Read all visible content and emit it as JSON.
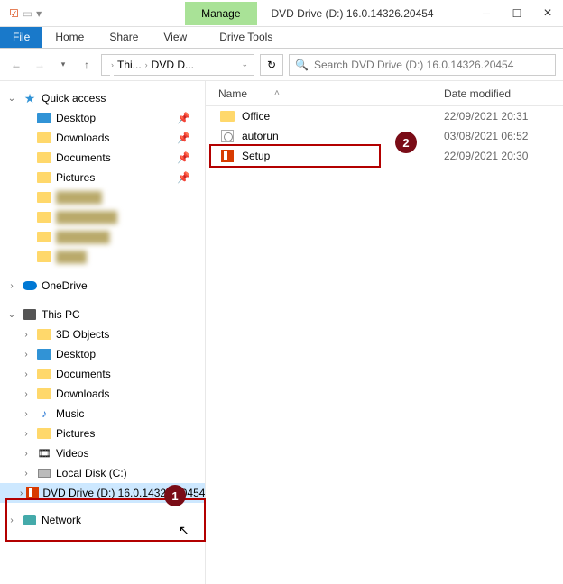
{
  "titlebar": {
    "manage": "Manage",
    "title": "DVD Drive (D:) 16.0.14326.20454"
  },
  "ribbon": {
    "file": "File",
    "home": "Home",
    "share": "Share",
    "view": "View",
    "drivetools": "Drive Tools"
  },
  "breadcrumb": {
    "item1": "Thi...",
    "item2": "DVD D..."
  },
  "search": {
    "placeholder": "Search DVD Drive (D:) 16.0.14326.20454"
  },
  "nav": {
    "quick_access": "Quick access",
    "desktop": "Desktop",
    "downloads": "Downloads",
    "documents": "Documents",
    "pictures": "Pictures",
    "onedrive": "OneDrive",
    "this_pc": "This PC",
    "objects3d": "3D Objects",
    "music": "Music",
    "videos": "Videos",
    "local_disk": "Local Disk (C:)",
    "dvd_drive": "DVD Drive (D:) 16.0.14326.20454",
    "network": "Network"
  },
  "columns": {
    "name": "Name",
    "date": "Date modified"
  },
  "files": {
    "office": {
      "name": "Office",
      "date": "22/09/2021 20:31"
    },
    "autorun": {
      "name": "autorun",
      "date": "03/08/2021 06:52"
    },
    "setup": {
      "name": "Setup",
      "date": "22/09/2021 20:30"
    }
  },
  "callouts": {
    "c1": "1",
    "c2": "2"
  }
}
